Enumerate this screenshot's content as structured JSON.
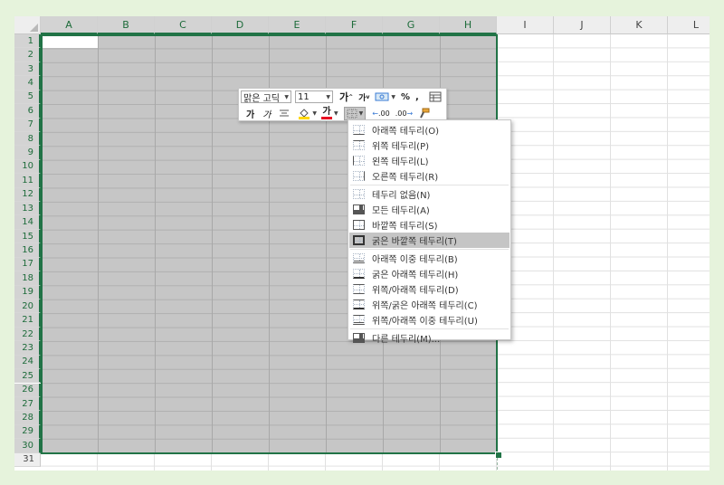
{
  "columns": [
    "A",
    "B",
    "C",
    "D",
    "E",
    "F",
    "G",
    "H",
    "I",
    "J",
    "K",
    "L"
  ],
  "rows": [
    "1",
    "2",
    "3",
    "4",
    "5",
    "6",
    "7",
    "8",
    "9",
    "10",
    "11",
    "12",
    "13",
    "14",
    "15",
    "16",
    "17",
    "18",
    "19",
    "20",
    "21",
    "22",
    "23",
    "24",
    "25",
    "26",
    "27",
    "28",
    "29",
    "30",
    "31"
  ],
  "selected_columns": [
    "A",
    "B",
    "C",
    "D",
    "E",
    "F",
    "G",
    "H"
  ],
  "selected_row_count": 30,
  "mini_toolbar": {
    "font_name": "맑은 고딕",
    "font_size": "11",
    "grow_font": "가",
    "shrink_font": "가",
    "percent": "%",
    "comma": ",",
    "bold": "가",
    "italic": "가",
    "font_color_glyph": "가",
    "decimal_increase": ".00",
    "decimal_decrease": ".00",
    "colors": {
      "fill": "#ffd700",
      "font": "#e81123",
      "accent": "#217346"
    }
  },
  "border_menu": {
    "items": [
      {
        "label": "아래쪽 테두리(O)",
        "icon": "border-bottom-icon"
      },
      {
        "label": "위쪽 테두리(P)",
        "icon": "border-top-icon"
      },
      {
        "label": "왼쪽 테두리(L)",
        "icon": "border-left-icon"
      },
      {
        "label": "오른쪽 테두리(R)",
        "icon": "border-right-icon"
      },
      {
        "label": "테두리 없음(N)",
        "icon": "border-none-icon"
      },
      {
        "label": "모든 테두리(A)",
        "icon": "border-all-icon"
      },
      {
        "label": "바깥쪽 테두리(S)",
        "icon": "border-outside-icon"
      },
      {
        "label": "굵은 바깥쪽 테두리(T)",
        "icon": "border-thick-outside-icon",
        "highlighted": true
      },
      {
        "label": "아래쪽 이중 테두리(B)",
        "icon": "border-double-bottom-icon"
      },
      {
        "label": "굵은 아래쪽 테두리(H)",
        "icon": "border-thick-bottom-icon"
      },
      {
        "label": "위쪽/아래쪽 테두리(D)",
        "icon": "border-top-bottom-icon"
      },
      {
        "label": "위쪽/굵은 아래쪽 테두리(C)",
        "icon": "border-top-thick-bottom-icon"
      },
      {
        "label": "위쪽/아래쪽 이중 테두리(U)",
        "icon": "border-top-double-bottom-icon"
      },
      {
        "label": "다른 테두리(M)...",
        "icon": "border-more-icon"
      }
    ]
  }
}
